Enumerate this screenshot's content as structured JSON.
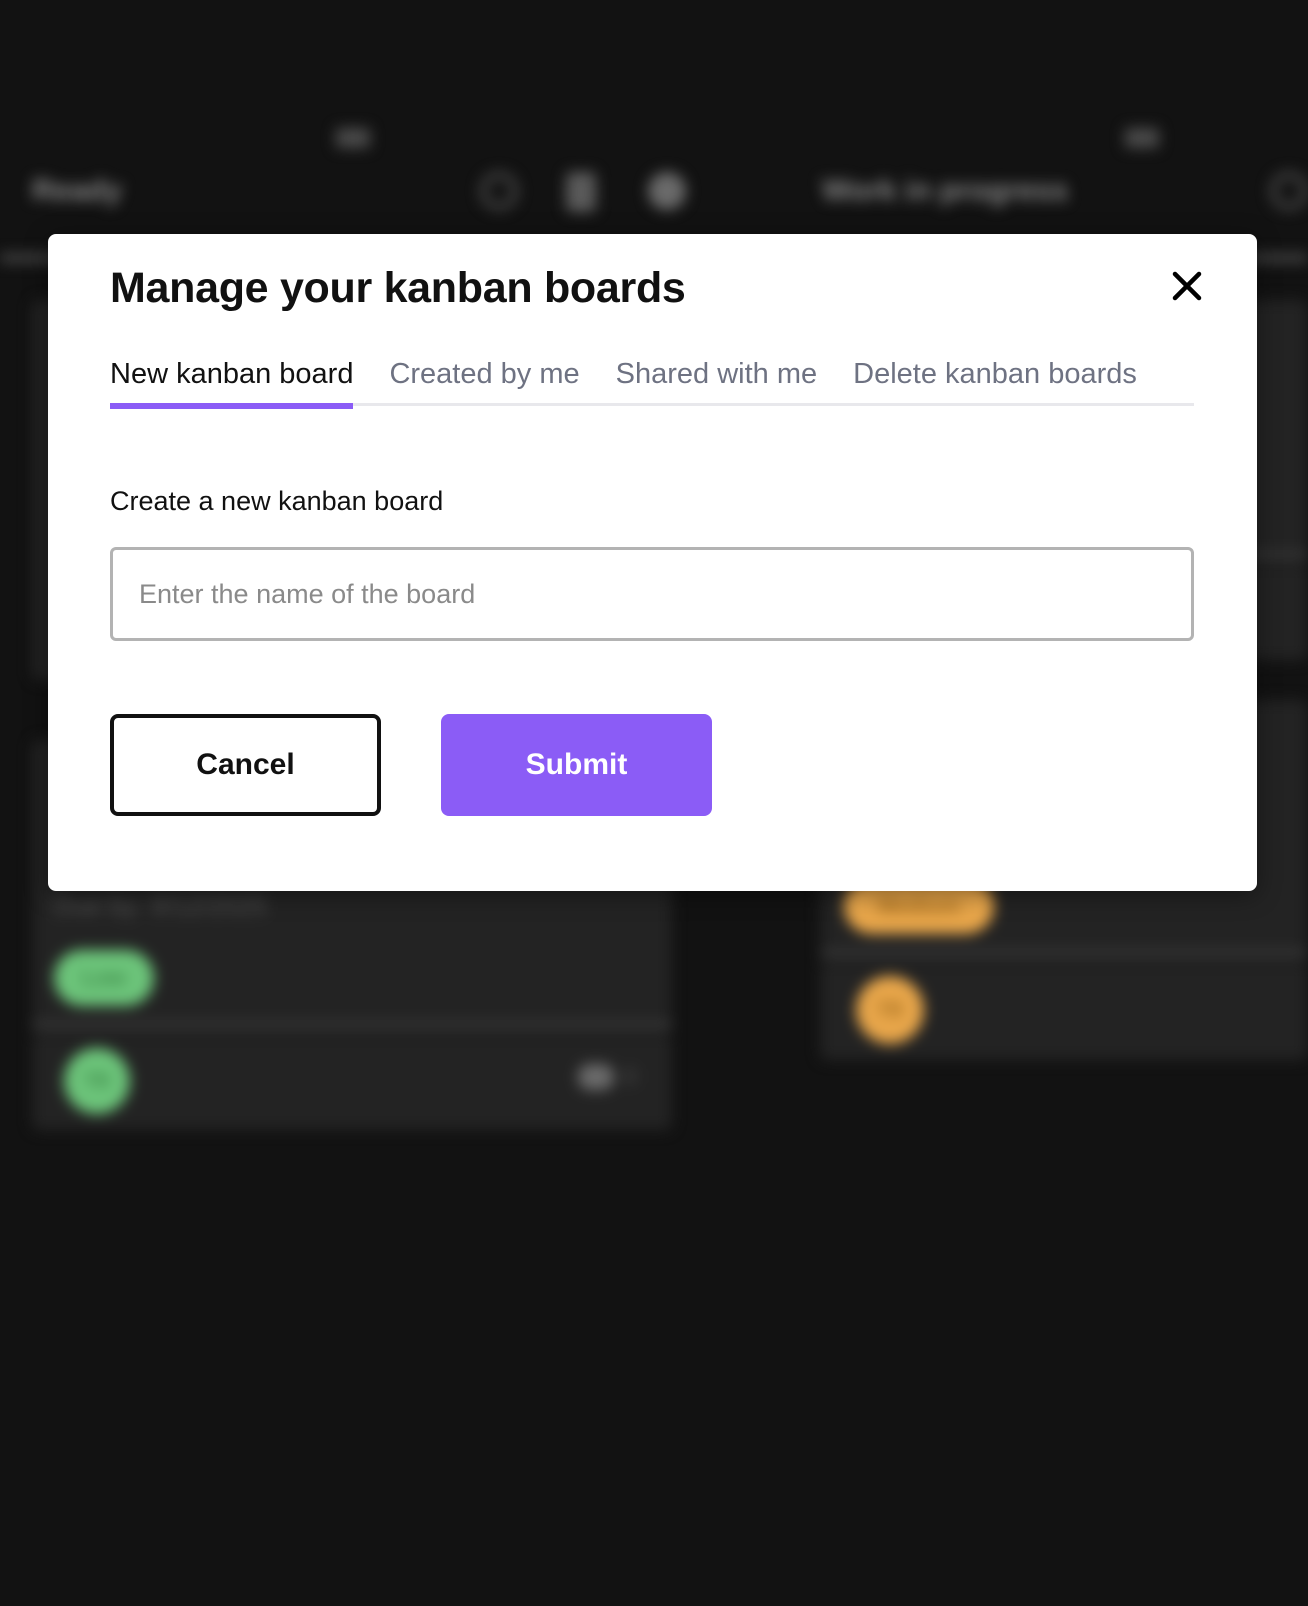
{
  "background": {
    "columns": [
      {
        "title": "Ready"
      },
      {
        "title": "Work in progress"
      }
    ],
    "cards": [
      {
        "due": "Due by: 9/12/2025",
        "priority": "Low",
        "avatar": "TB",
        "comments": "0"
      },
      {
        "priority": "Medium",
        "avatar": "TB"
      }
    ]
  },
  "modal": {
    "title": "Manage your kanban boards",
    "tabs": [
      {
        "label": "New kanban board",
        "active": true
      },
      {
        "label": "Created by me"
      },
      {
        "label": "Shared with me"
      },
      {
        "label": "Delete kanban boards"
      }
    ],
    "section_label": "Create a new kanban board",
    "input": {
      "placeholder": "Enter the name of the board",
      "value": ""
    },
    "cancel_label": "Cancel",
    "submit_label": "Submit"
  },
  "colors": {
    "accent": "#8b5cf6",
    "overlay": "#121212",
    "priority_low": "#6cc47a",
    "priority_medium": "#e8a64a"
  },
  "icons": [
    "close-icon"
  ]
}
